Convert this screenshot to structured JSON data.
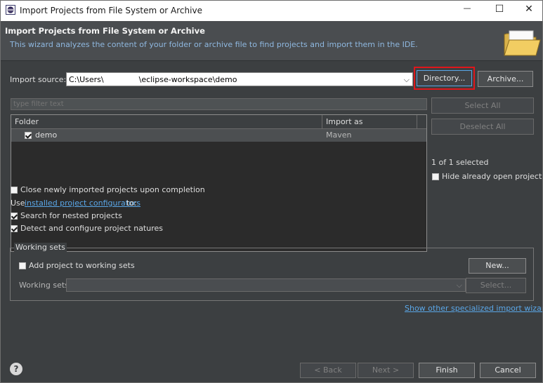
{
  "window": {
    "title": "Import Projects from File System or Archive",
    "minimize_glyph": "—",
    "maximize_glyph": "☐",
    "close_glyph": "✕"
  },
  "header": {
    "title": "Import Projects from File System or Archive",
    "description": "This wizard analyzes the content of your folder or archive file to find projects and import them in the IDE."
  },
  "import_source": {
    "label": "Import source:",
    "path_prefix": "C:\\Users\\",
    "path_suffix": "\\eclipse-workspace\\demo",
    "directory_button": "Directory...",
    "archive_button": "Archive..."
  },
  "filter": {
    "placeholder": "type filter text"
  },
  "projects_table": {
    "columns": [
      "Folder",
      "Import as"
    ],
    "rows": [
      {
        "folder": "demo",
        "import_as": "Maven",
        "checked": true
      }
    ]
  },
  "selection": {
    "select_all": "Select All",
    "deselect_all": "Deselect All",
    "status": "1 of 1 selected",
    "hide_open_label": "Hide already open projects"
  },
  "options": {
    "close_label": "Close newly imported projects upon completion",
    "use_prefix": "Use",
    "configurators_link": "installed project configurators",
    "use_suffix": "to:",
    "search_nested_label": "Search for nested projects",
    "detect_label": "Detect and configure project natures"
  },
  "working_sets": {
    "group_title": "Working sets",
    "add_label": "Add project to working sets",
    "new_button": "New...",
    "sets_label": "Working sets:",
    "select_button": "Select..."
  },
  "links": {
    "other_wizards": "Show other specialized import wizards"
  },
  "footer": {
    "back": "< Back",
    "next": "Next >",
    "finish": "Finish",
    "cancel": "Cancel",
    "help_glyph": "?"
  },
  "colors": {
    "highlight": "#e0161b",
    "link": "#5aa7e8",
    "header_text": "#8fb8e0"
  }
}
